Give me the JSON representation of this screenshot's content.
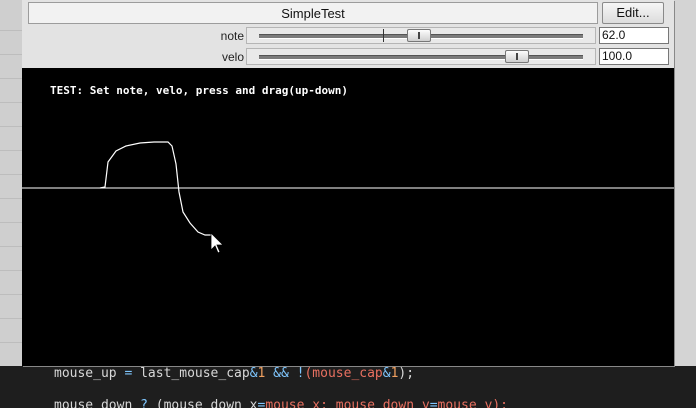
{
  "plugin": {
    "title": "SimpleTest",
    "edit_label": "Edit...",
    "params": [
      {
        "label": "note",
        "value_text": "62.0",
        "position": 0.49
      },
      {
        "label": "velo",
        "value_text": "100.0",
        "position": 0.79
      }
    ]
  },
  "canvas": {
    "instruction": "TEST: Set note, velo, press and drag(up-down)"
  },
  "editor": {
    "line1": {
      "a": "mouse_up ",
      "op1": "=",
      "b": " last_mouse_cap",
      "op2": "&",
      "n1": "1",
      "op3": " && !",
      "c": "(mouse_cap",
      "op4": "&",
      "n2": "1",
      "d": ");"
    },
    "line2": {
      "a": "mouse_down ",
      "op1": "?",
      "b": " (mouse_down_x",
      "op2": "=",
      "c": "mouse_x; mouse_down_y",
      "op3": "=",
      "d": "mouse_y);"
    }
  },
  "colors": {
    "canvas_bg": "#000000",
    "trace": "#ffffff",
    "panel": "#e3e3e3"
  }
}
